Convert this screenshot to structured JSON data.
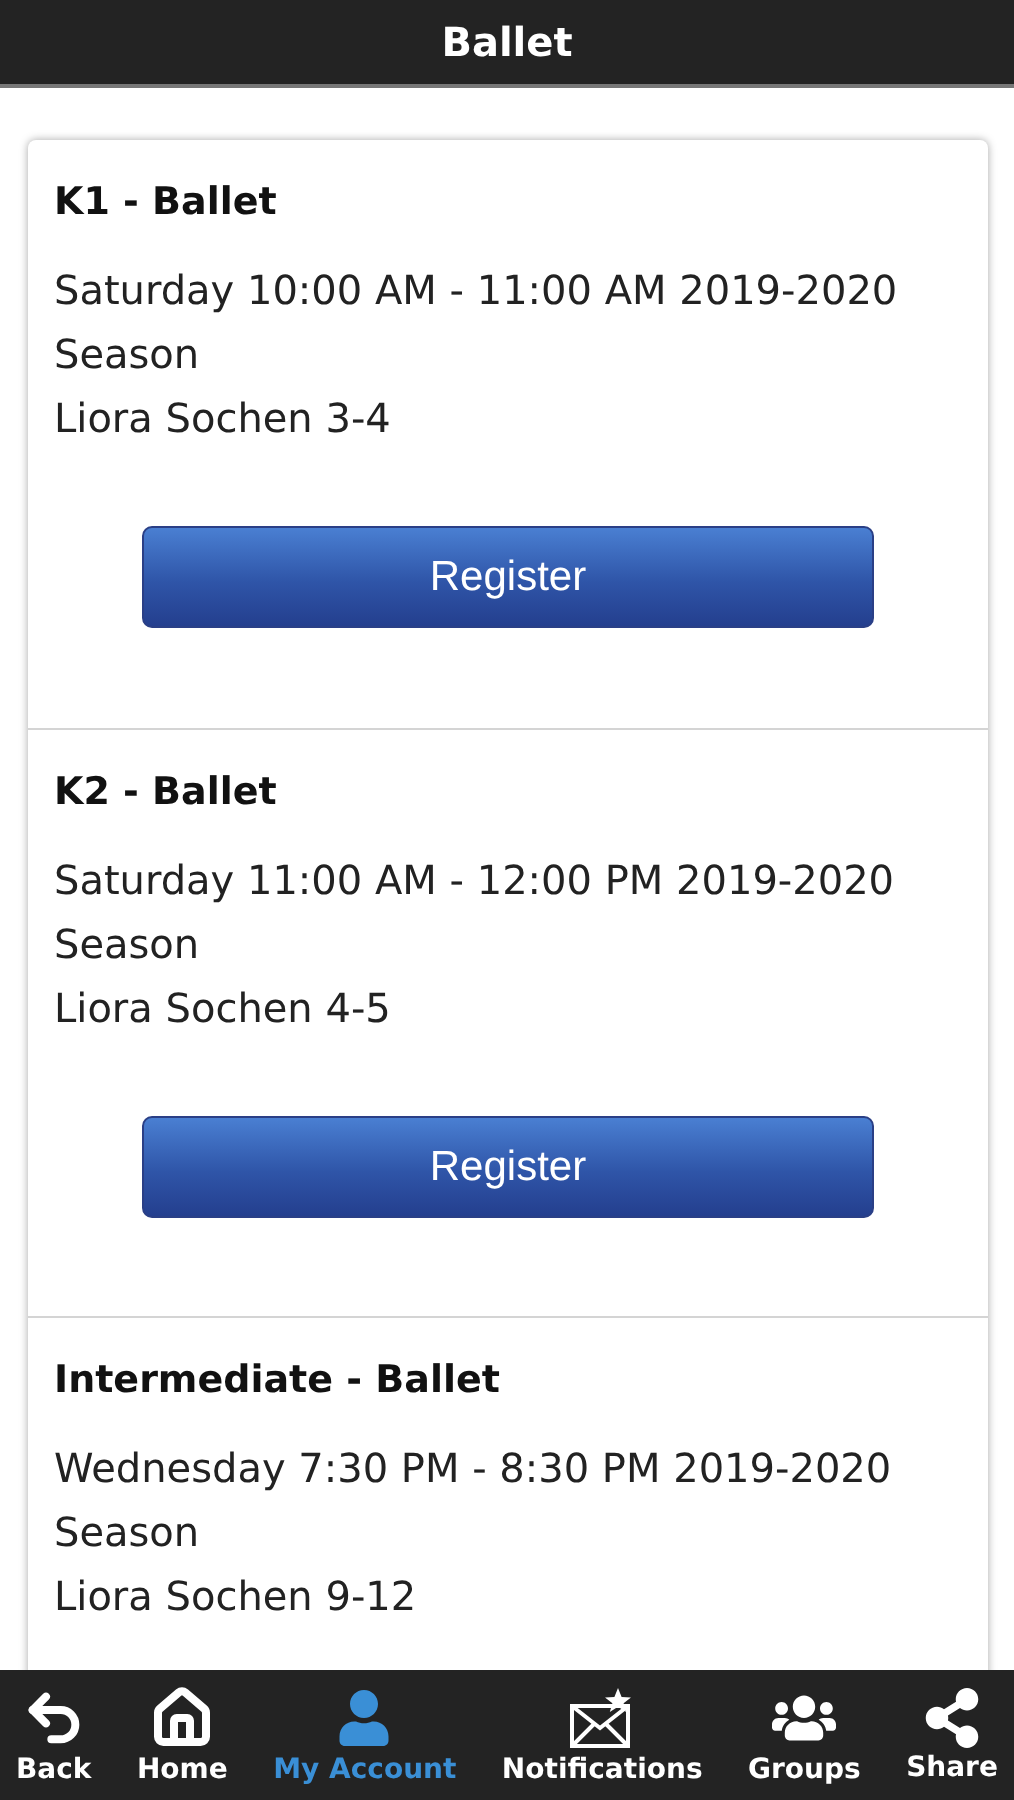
{
  "header": {
    "title": "Ballet"
  },
  "classes": [
    {
      "name": "K1 - Ballet",
      "schedule": "Saturday 10:00 AM - 11:00 AM 2019-2020 Season",
      "instructor": "Liora Sochen 3-4",
      "button": "Register"
    },
    {
      "name": "K2 - Ballet",
      "schedule": "Saturday 11:00 AM - 12:00 PM 2019-2020 Season",
      "instructor": "Liora Sochen 4-5",
      "button": "Register"
    },
    {
      "name": "Intermediate - Ballet",
      "schedule": "Wednesday 7:30 PM - 8:30 PM 2019-2020 Season",
      "instructor": "Liora Sochen 9-12"
    }
  ],
  "nav": [
    {
      "kind": "back",
      "label": "Back",
      "selected": false
    },
    {
      "kind": "home",
      "label": "Home",
      "selected": false
    },
    {
      "kind": "account",
      "label": "My Account",
      "selected": true
    },
    {
      "kind": "notifications",
      "label": "Notifications",
      "selected": false
    },
    {
      "kind": "groups",
      "label": "Groups",
      "selected": false
    },
    {
      "kind": "share",
      "label": "Share",
      "selected": false
    }
  ]
}
